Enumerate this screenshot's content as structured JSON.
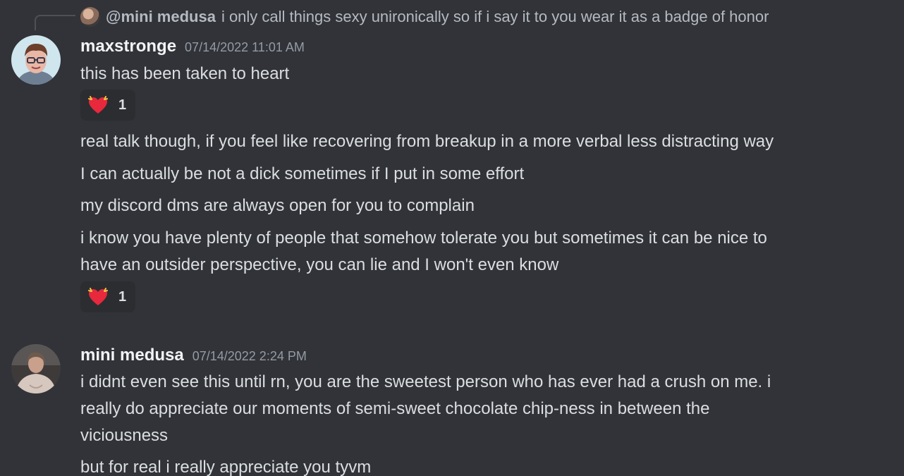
{
  "reply": {
    "author": "@mini medusa",
    "text": "i only call things sexy unironically so if i say it to you wear it as a badge of honor"
  },
  "messages": [
    {
      "author": "maxstronge",
      "timestamp": "07/14/2022 11:01 AM",
      "lines": [
        "this has been taken to heart"
      ],
      "reaction": {
        "emoji": "heart-with-sparkles",
        "count": "1"
      },
      "followups": [
        "real talk though, if you feel like recovering from breakup in a more verbal less distracting way",
        "I can actually be not a dick sometimes if I put in some effort",
        "my discord dms are always open for you to complain",
        "i know you have plenty of people that somehow tolerate you but sometimes it can be nice to",
        "have an outsider perspective, you can lie and I won't even know"
      ],
      "followup_reaction": {
        "emoji": "heart-with-sparkles",
        "count": "1"
      }
    },
    {
      "author": "mini medusa",
      "timestamp": "07/14/2022 2:24 PM",
      "lines": [
        "i didnt even see this until rn, you are the sweetest person who has ever had a crush on me. i",
        "really do appreciate our moments of semi-sweet chocolate chip-ness in between the",
        "viciousness",
        "but for real i really appreciate you tyvm"
      ]
    }
  ],
  "colors": {
    "background": "#313338",
    "author": "#f2f3f5",
    "text": "#dbdee1",
    "muted": "#949ba4",
    "reaction_bg": "#2b2d31",
    "heart": "#e8283c"
  }
}
